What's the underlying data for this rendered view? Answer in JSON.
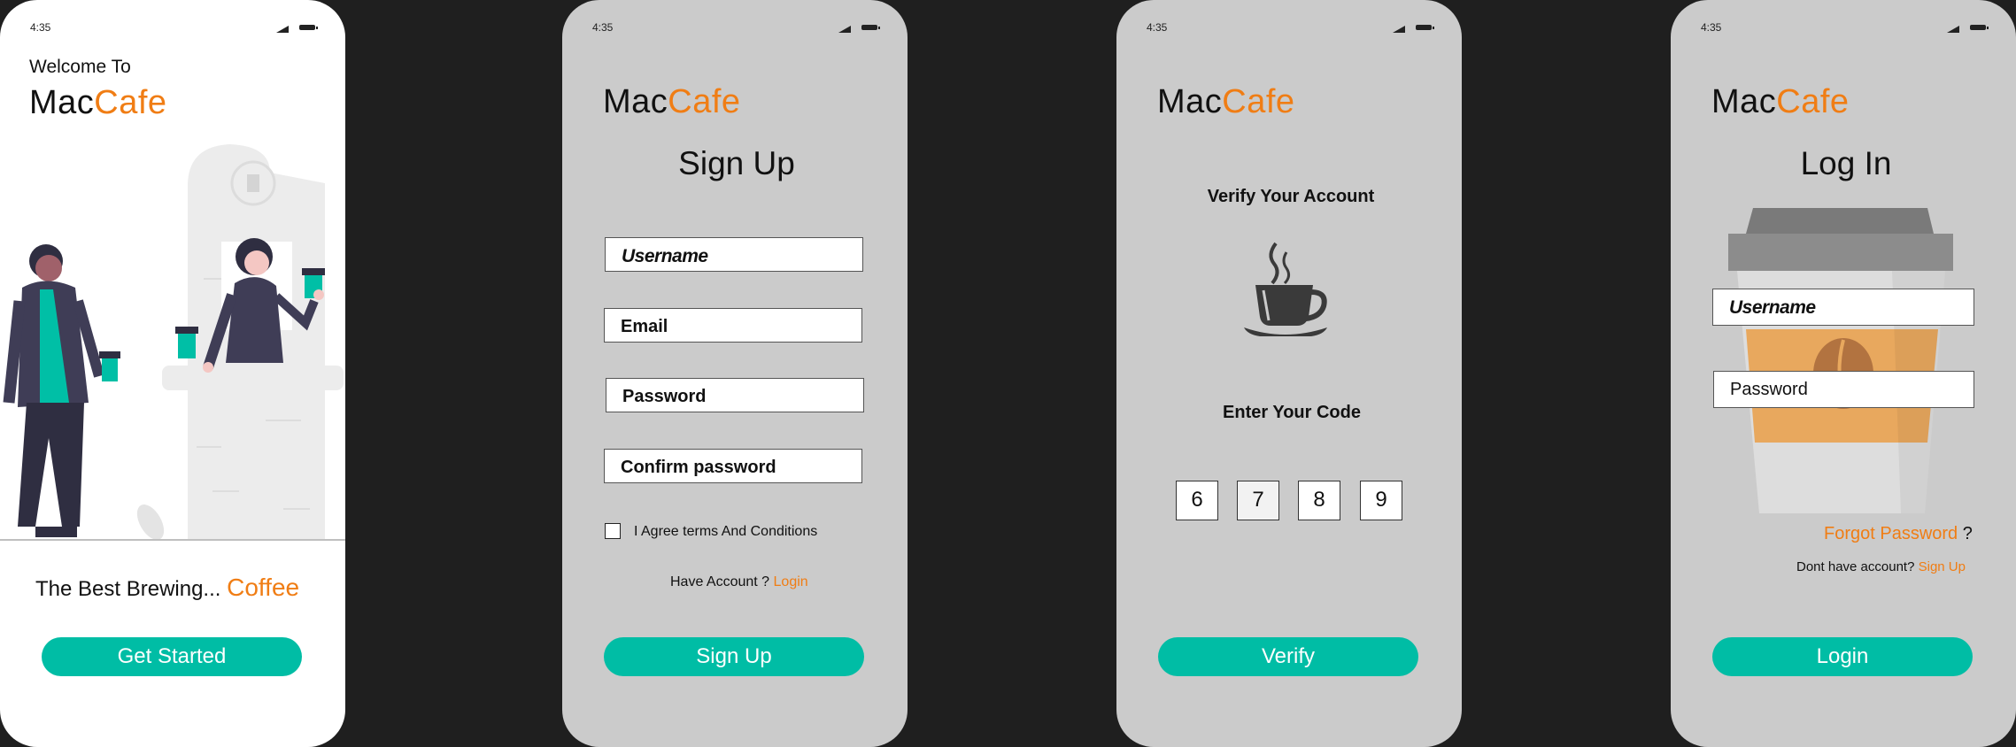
{
  "status_time": "4:35",
  "screens": {
    "welcome": {
      "greeting": "Welcome To",
      "brand_a": "Mac",
      "brand_b": "Cafe",
      "tagline": "The Best Brewing...",
      "tagline_accent": "Coffee",
      "cta": "Get Started"
    },
    "signup": {
      "brand_a": "Mac",
      "brand_b": "Cafe",
      "title": "Sign Up",
      "fields": [
        "Username",
        "Email",
        "Password",
        "Confirm password"
      ],
      "agree_label": "I Agree terms And Conditions",
      "have_account": "Have Account ?",
      "login_link": "Login",
      "submit": "Sign Up"
    },
    "verify": {
      "brand_a": "Mac",
      "brand_b": "Cafe",
      "heading": "Verify Your Account",
      "code_label": "Enter Your Code",
      "code": [
        "6",
        "7",
        "8",
        "9"
      ],
      "submit": "Verify"
    },
    "login": {
      "brand_a": "Mac",
      "brand_b": "Cafe",
      "title": "Log In",
      "fields": [
        "Username",
        "Password"
      ],
      "forgot": "Forgot Password",
      "forgot_q": "?",
      "no_account": "Dont have account?",
      "signup_link": "Sign Up",
      "submit": "Login"
    }
  },
  "colors": {
    "accent": "#f07d14",
    "primary": "#00bda5",
    "bg": "#1f1f1f",
    "screen_grey": "#cbcbcb"
  }
}
